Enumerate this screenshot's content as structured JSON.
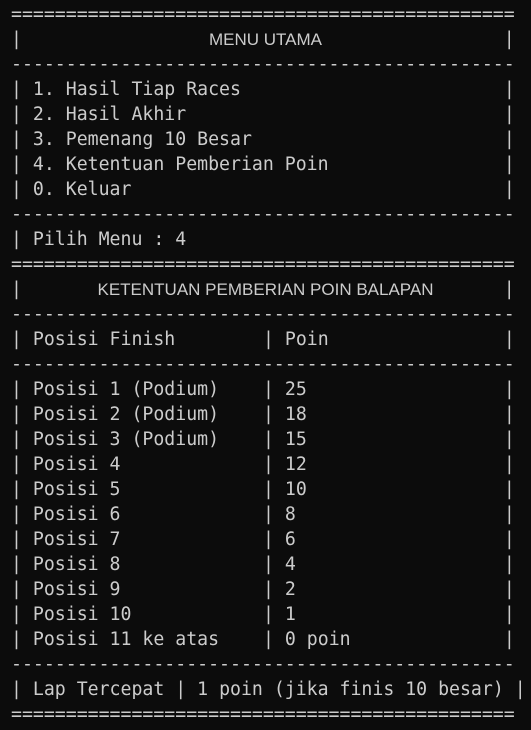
{
  "menu": {
    "title": "MENU UTAMA",
    "items": [
      "1. Hasil Tiap Races",
      "2. Hasil Akhir",
      "3. Pemenang 10 Besar",
      "4. Ketentuan Pemberian Poin",
      "0. Keluar"
    ],
    "prompt": "Pilih Menu : 4"
  },
  "points_table": {
    "title": "KETENTUAN PEMBERIAN POIN BALAPAN",
    "header": {
      "position": "Posisi Finish",
      "points": "Poin"
    },
    "rows": [
      {
        "position": "Posisi 1 (Podium)",
        "points": "25"
      },
      {
        "position": "Posisi 2 (Podium)",
        "points": "18"
      },
      {
        "position": "Posisi 3 (Podium)",
        "points": "15"
      },
      {
        "position": "Posisi 4",
        "points": "12"
      },
      {
        "position": "Posisi 5",
        "points": "10"
      },
      {
        "position": "Posisi 6",
        "points": "8"
      },
      {
        "position": "Posisi 7",
        "points": "6"
      },
      {
        "position": "Posisi 8",
        "points": "4"
      },
      {
        "position": "Posisi 9",
        "points": "2"
      },
      {
        "position": "Posisi 10",
        "points": "1"
      },
      {
        "position": "Posisi 11 ke atas",
        "points": "0 poin"
      }
    ],
    "fastest_lap": {
      "label": "Lap Tercepat",
      "value": "1 poin (jika finis 10 besar)"
    }
  }
}
